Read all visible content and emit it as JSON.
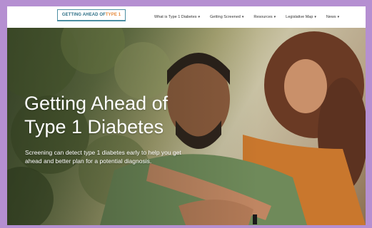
{
  "header": {
    "logo": {
      "part1": "GETTING AHEAD OF ",
      "part2": "TYPE 1"
    },
    "nav": [
      {
        "label": "What is Type 1 Diabetes"
      },
      {
        "label": "Getting Screened"
      },
      {
        "label": "Resources"
      },
      {
        "label": "Legislative Map"
      },
      {
        "label": "News"
      }
    ]
  },
  "hero": {
    "title_line1": "Getting Ahead of",
    "title_line2": "Type 1 Diabetes",
    "subtitle_line1": "Screening can detect type 1 diabetes early to help you get",
    "subtitle_line2": "ahead and better plan for a potential diagnosis."
  },
  "colors": {
    "page_border": "#b58fd1",
    "logo_teal": "#2d6f86",
    "logo_orange": "#e5893b"
  }
}
